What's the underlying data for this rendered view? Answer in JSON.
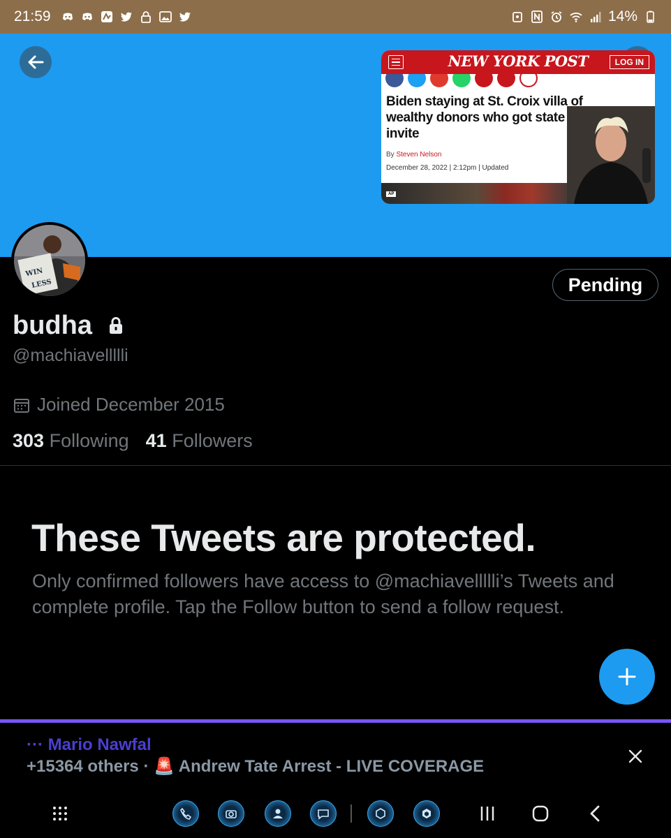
{
  "status_bar": {
    "time": "21:59",
    "battery": "14%"
  },
  "banner": {
    "news_card": {
      "logo": "NEW YORK POST",
      "login_label": "LOG IN",
      "headline": "Biden staying at St. Croix villa of wealthy donors who got state dinr invite",
      "byline_prefix": "By",
      "author": "Steven Nelson",
      "date": "December 28, 2022",
      "time": "2:12pm",
      "updated": "Updated",
      "photo_credit": "AP"
    }
  },
  "profile": {
    "display_name": "budha",
    "handle": "@machiavellllli",
    "joined": "Joined December 2015",
    "following_count": "303",
    "following_label": "Following",
    "followers_count": "41",
    "followers_label": "Followers",
    "pending_label": "Pending"
  },
  "protected": {
    "title": "These Tweets are protected.",
    "body": "Only confirmed followers have access to @machiavellllli’s Tweets and complete profile. Tap the Follow button to send a follow request."
  },
  "space_bar": {
    "host": "··· Mario Nawfal",
    "title": "+15364 others · 🚨 Andrew Tate Arrest - LIVE COVERAGE"
  },
  "colors": {
    "accent": "#1d9bf0",
    "status_bar": "#8d6e4a",
    "space_border": "#7856ff"
  }
}
